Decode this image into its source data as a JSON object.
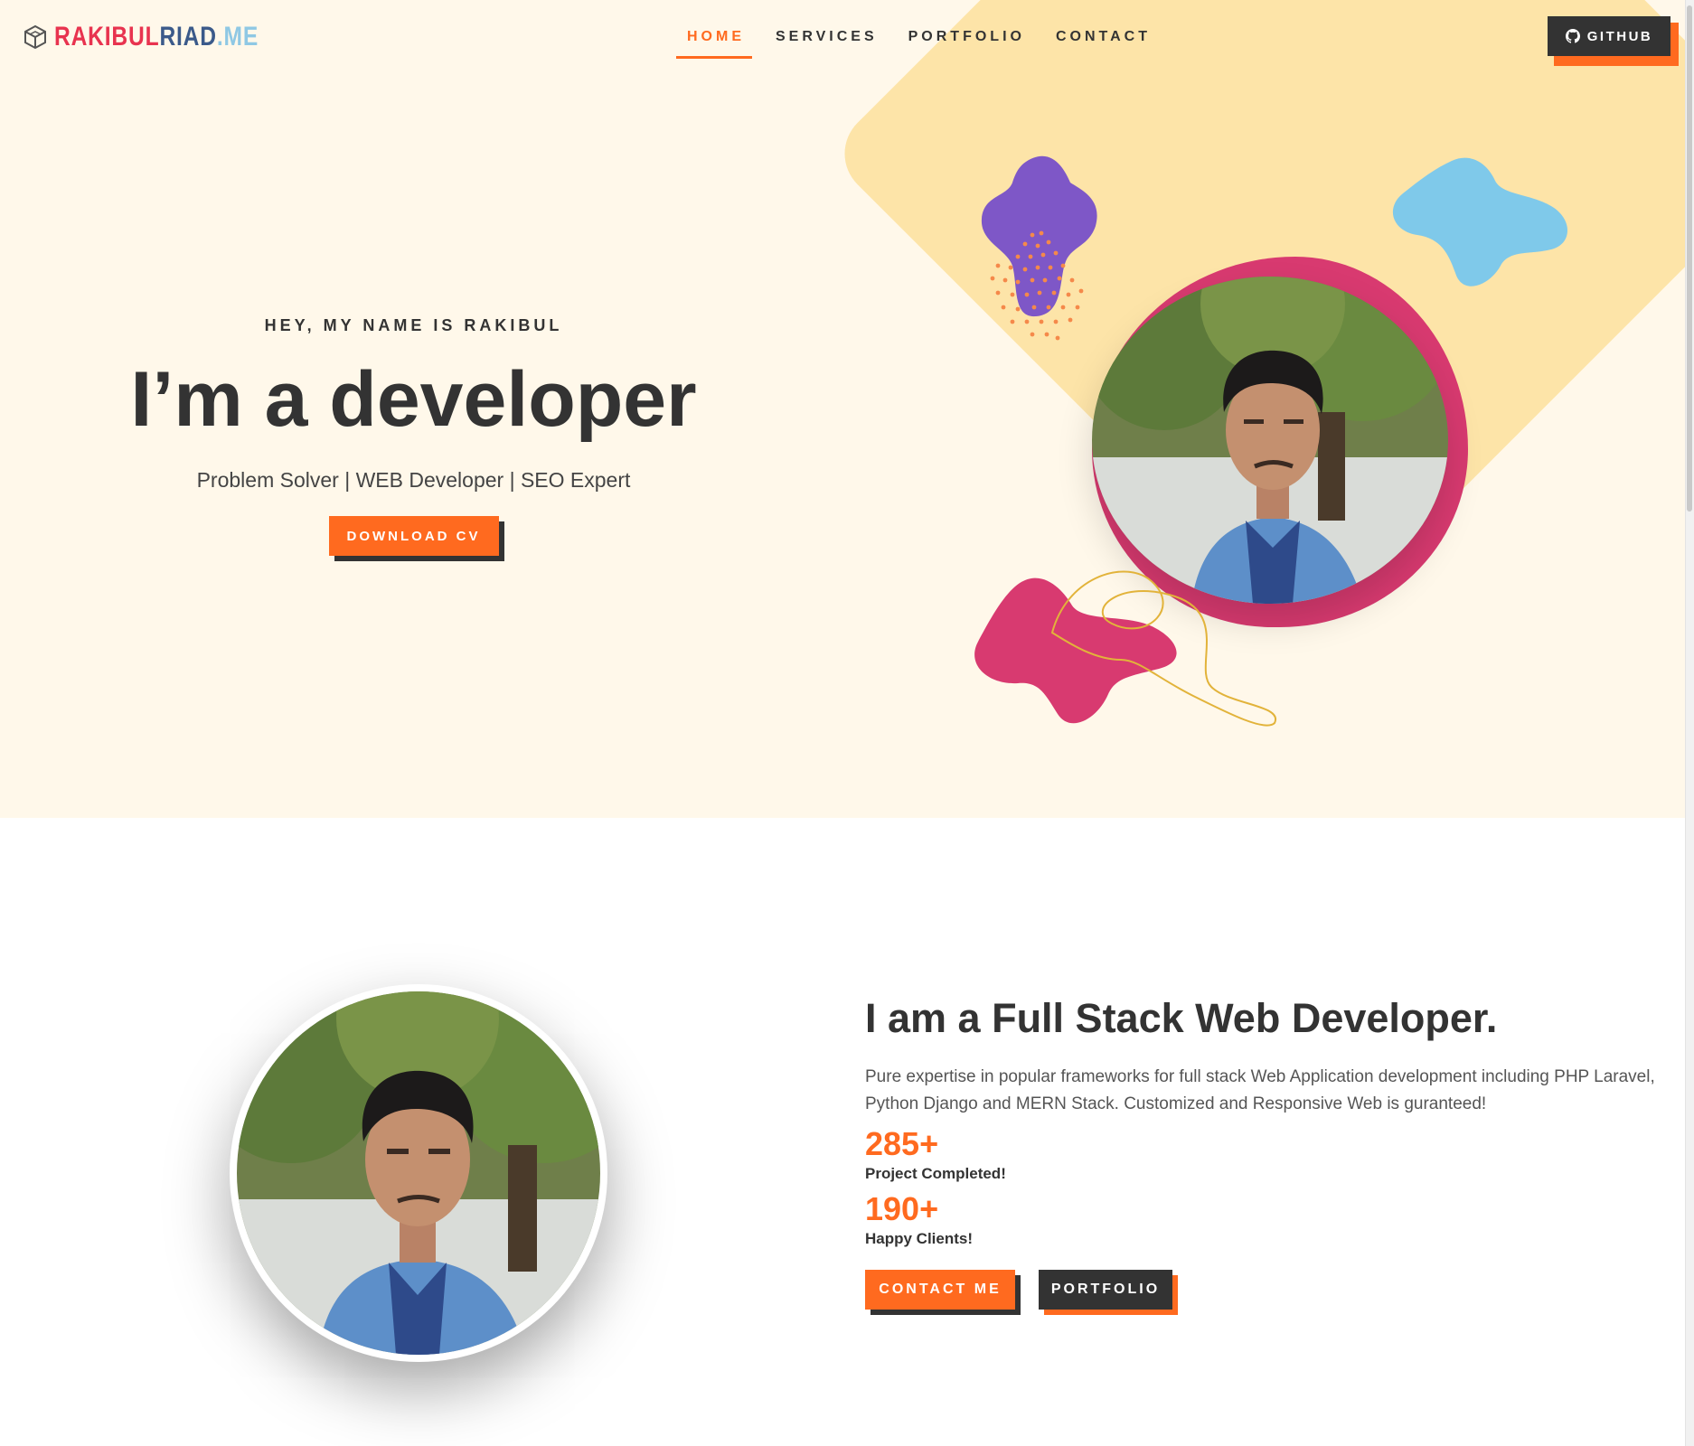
{
  "header": {
    "logo": {
      "part1": "RAKIBUL",
      "part2": "RIAD",
      "part3": ".ME"
    },
    "nav": [
      "HOME",
      "SERVICES",
      "PORTFOLIO",
      "CONTACT"
    ],
    "active_nav": "HOME",
    "github_label": "GITHUB"
  },
  "hero": {
    "greeting": "HEY, MY NAME IS RAKIBUL",
    "headline": "I’m a developer",
    "tagline": "Problem Solver | WEB Developer | SEO Expert",
    "cta_label": "DOWNLOAD CV"
  },
  "about": {
    "title": "I am a Full Stack Web Developer.",
    "description": "Pure expertise in popular frameworks for full stack Web Application development including PHP Laravel, Python Django and MERN Stack. Customized and Responsive Web is guranteed!",
    "stats": [
      {
        "value": "285+",
        "label": "Project Completed!"
      },
      {
        "value": "190+",
        "label": "Happy Clients!"
      }
    ],
    "contact_label": "CONTACT ME",
    "portfolio_label": "PORTFOLIO"
  },
  "colors": {
    "accent": "#ff6a1f",
    "dark": "#333333",
    "hero_bg": "#fff8ea",
    "diamond": "#fde4a8",
    "blob_purple": "#7e57c7",
    "blob_blue": "#7fc9ea",
    "blob_pink": "#d83a70"
  },
  "icons": [
    "cube-logo-icon",
    "github-icon"
  ]
}
